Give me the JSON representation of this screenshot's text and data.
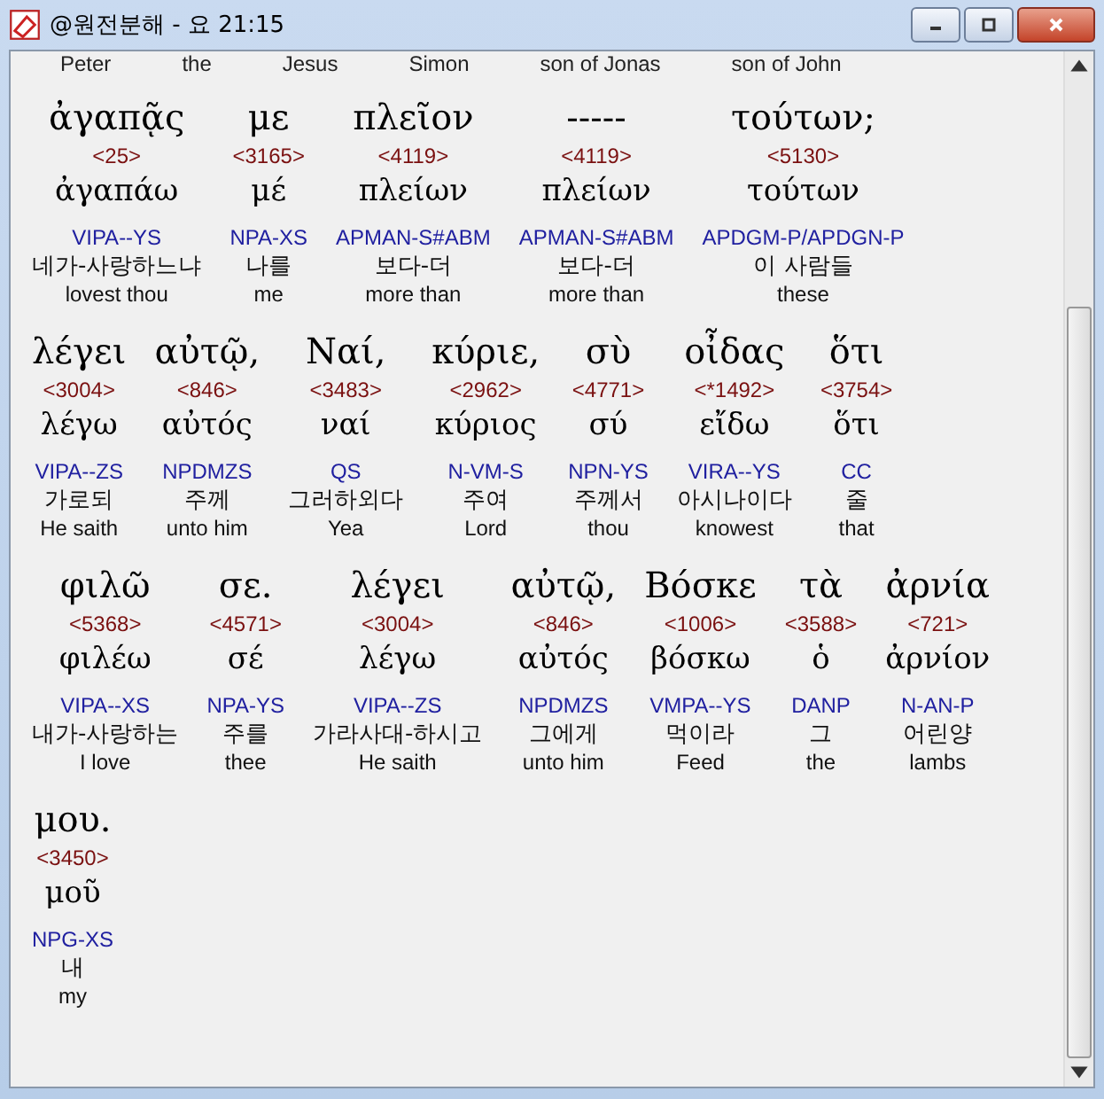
{
  "window": {
    "title": "@원전분해 - 요 21:15"
  },
  "cut_off_glosses": [
    "Peter",
    "the",
    "Jesus",
    "Simon",
    "son of Jonas",
    "son of John"
  ],
  "lines": [
    [
      {
        "greek": "ἀγαπᾷς",
        "strong": "<25>",
        "lemma": "ἀγαπάω",
        "parse": "VIPA--YS",
        "korean": "네가-사랑하느냐",
        "english": "lovest thou"
      },
      {
        "greek": "με",
        "strong": "<3165>",
        "lemma": "μέ",
        "parse": "NPA-XS",
        "korean": "나를",
        "english": "me"
      },
      {
        "greek": "πλεῖον",
        "strong": "<4119>",
        "lemma": "πλείων",
        "parse": "APMAN-S#ABM",
        "korean": "보다-더",
        "english": "more than"
      },
      {
        "greek": "-----",
        "strong": "<4119>",
        "lemma": "πλείων",
        "parse": "APMAN-S#ABM",
        "korean": "보다-더",
        "english": "more than"
      },
      {
        "greek": "τούτων;",
        "strong": "<5130>",
        "lemma": "τούτων",
        "parse": "APDGM-P/APDGN-P",
        "korean": "이 사람들",
        "english": "these"
      }
    ],
    [
      {
        "greek": "λέγει",
        "strong": "<3004>",
        "lemma": "λέγω",
        "parse": "VIPA--ZS",
        "korean": "가로되",
        "english": "He saith"
      },
      {
        "greek": "αὐτῷ,",
        "strong": "<846>",
        "lemma": "αὐτός",
        "parse": "NPDMZS",
        "korean": "주께",
        "english": "unto him"
      },
      {
        "greek": "Ναί,",
        "strong": "<3483>",
        "lemma": "ναί",
        "parse": "QS",
        "korean": "그러하외다",
        "english": "Yea"
      },
      {
        "greek": "κύριε,",
        "strong": "<2962>",
        "lemma": "κύριος",
        "parse": "N-VM-S",
        "korean": "주여",
        "english": "Lord"
      },
      {
        "greek": "σὺ",
        "strong": "<4771>",
        "lemma": "σύ",
        "parse": "NPN-YS",
        "korean": "주께서",
        "english": "thou"
      },
      {
        "greek": "οἶδας",
        "strong": "<*1492>",
        "lemma": "εἴδω",
        "parse": "VIRA--YS",
        "korean": "아시나이다",
        "english": "knowest"
      },
      {
        "greek": "ὅτι",
        "strong": "<3754>",
        "lemma": "ὅτι",
        "parse": "CC",
        "korean": "줄",
        "english": "that"
      }
    ],
    [
      {
        "greek": "φιλῶ",
        "strong": "<5368>",
        "lemma": "φιλέω",
        "parse": "VIPA--XS",
        "korean": "내가-사랑하는",
        "english": "I love"
      },
      {
        "greek": "σε.",
        "strong": "<4571>",
        "lemma": "σέ",
        "parse": "NPA-YS",
        "korean": "주를",
        "english": "thee"
      },
      {
        "greek": "λέγει",
        "strong": "<3004>",
        "lemma": "λέγω",
        "parse": "VIPA--ZS",
        "korean": "가라사대-하시고",
        "english": "He saith"
      },
      {
        "greek": "αὐτῷ,",
        "strong": "<846>",
        "lemma": "αὐτός",
        "parse": "NPDMZS",
        "korean": "그에게",
        "english": "unto him"
      },
      {
        "greek": "Βόσκε",
        "strong": "<1006>",
        "lemma": "βόσκω",
        "parse": "VMPA--YS",
        "korean": "먹이라",
        "english": "Feed"
      },
      {
        "greek": "τὰ",
        "strong": "<3588>",
        "lemma": "ὁ",
        "parse": "DANP",
        "korean": "그",
        "english": "the"
      },
      {
        "greek": "ἀρνία",
        "strong": "<721>",
        "lemma": "ἀρνίον",
        "parse": "N-AN-P",
        "korean": "어린양",
        "english": "lambs"
      }
    ],
    [
      {
        "greek": "μου.",
        "strong": "<3450>",
        "lemma": "μοῦ",
        "parse": "NPG-XS",
        "korean": "내",
        "english": "my"
      }
    ]
  ]
}
